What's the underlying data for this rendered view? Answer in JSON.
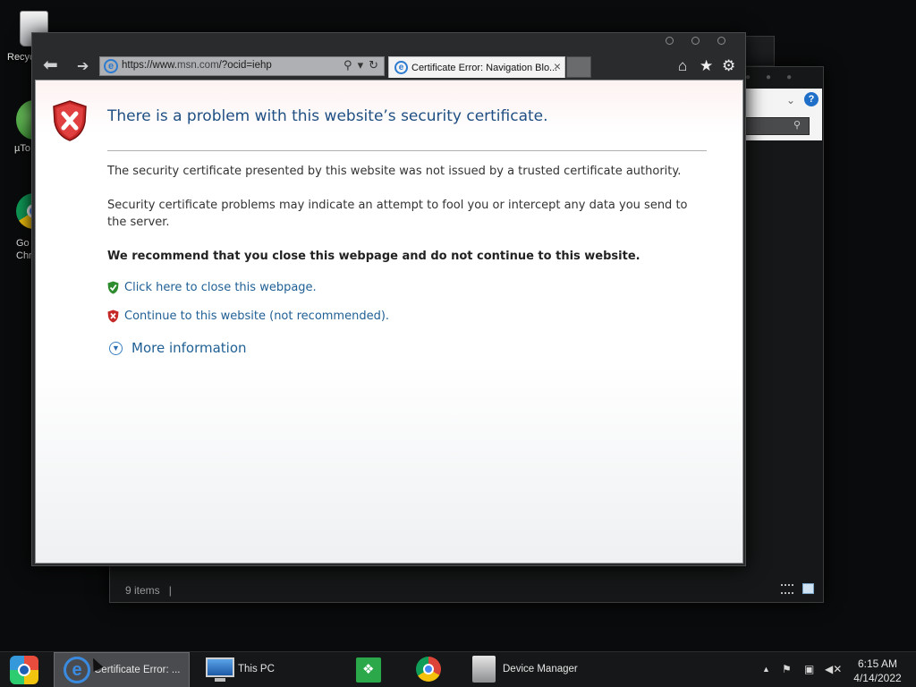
{
  "desktop": {
    "icons": [
      {
        "label": "Recyc"
      },
      {
        "label": "µTo"
      },
      {
        "label_line1": "Go",
        "label_line2": "Chr"
      }
    ]
  },
  "explorer": {
    "status_items": "9 items",
    "status_sep": "|"
  },
  "browser": {
    "address": {
      "scheme": "https://www.",
      "host": "msn.com",
      "path": "/?ocid=iehp"
    },
    "tabs": [
      {
        "title": "Certificate Error: Navigation Blo...",
        "close": "×"
      }
    ],
    "icons": {
      "back": "back-arrow-icon",
      "forward": "forward-arrow-icon",
      "home": "home-icon",
      "favorites": "star-icon",
      "tools": "gear-icon"
    }
  },
  "page": {
    "title": "There is a problem with this website’s security certificate.",
    "paragraph1": "The security certificate presented by this website was not issued by a trusted certificate authority.",
    "paragraph2": "Security certificate problems may indicate an attempt to fool you or intercept any data you send to the server.",
    "recommendation": "We recommend that you close this webpage and do not continue to this website.",
    "close_link": "Click here to close this webpage.",
    "continue_link": "Continue to this website (not recommended).",
    "more_info": "More information"
  },
  "taskbar": {
    "items": [
      {
        "label": "Certificate Error: ..."
      },
      {
        "label": "This PC"
      },
      {
        "label": "Device Manager"
      }
    ],
    "clock": {
      "time": "6:15 AM",
      "date": "4/14/2022"
    }
  },
  "colors": {
    "title_blue": "#1f4f83",
    "link_blue": "#1f5f94",
    "shield_red": "#c62828",
    "shield_green": "#2e8b2e"
  }
}
